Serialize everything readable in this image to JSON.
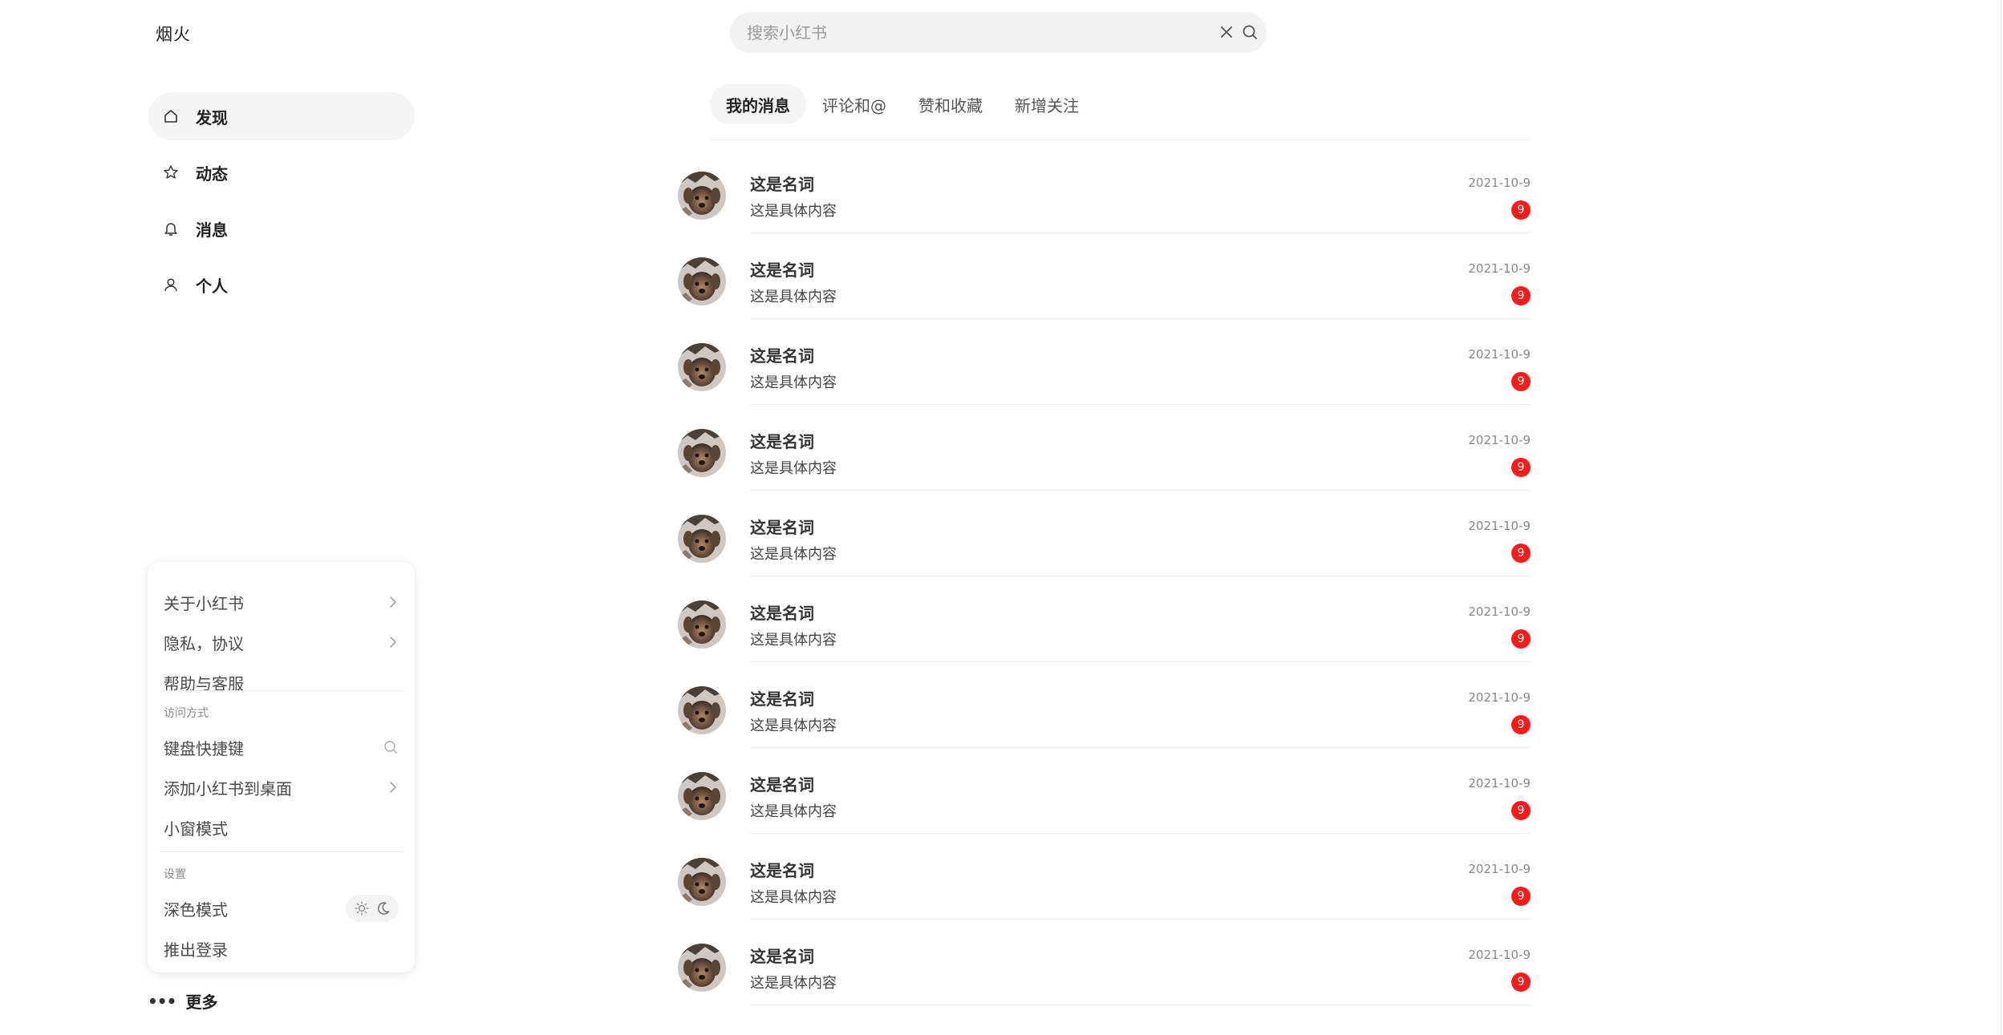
{
  "app": {
    "logo": "烟火"
  },
  "search": {
    "placeholder": "搜索小红书",
    "value": ""
  },
  "sidebar": {
    "items": [
      {
        "label": "发现",
        "icon": "home-icon",
        "active": true
      },
      {
        "label": "动态",
        "icon": "star-icon",
        "active": false
      },
      {
        "label": "消息",
        "icon": "bell-icon",
        "active": false
      },
      {
        "label": "个人",
        "icon": "user-icon",
        "active": false
      }
    ],
    "more_label": "更多"
  },
  "menu": {
    "about": "关于小红书",
    "privacy": "隐私，协议",
    "help": "帮助与客服",
    "access_section": "访问方式",
    "shortcuts": "键盘快捷键",
    "add_to_desktop": "添加小红书到桌面",
    "mini_window": "小窗模式",
    "settings_section": "设置",
    "dark_mode": "深色模式",
    "logout": "推出登录"
  },
  "tabs": [
    {
      "label": "我的消息",
      "active": true
    },
    {
      "label": "评论和@",
      "active": false
    },
    {
      "label": "赞和收藏",
      "active": false
    },
    {
      "label": "新增关注",
      "active": false
    }
  ],
  "messages": [
    {
      "name": "这是名词",
      "content": "这是具体内容",
      "time": "2021-10-9",
      "badge": "9"
    },
    {
      "name": "这是名词",
      "content": "这是具体内容",
      "time": "2021-10-9",
      "badge": "9"
    },
    {
      "name": "这是名词",
      "content": "这是具体内容",
      "time": "2021-10-9",
      "badge": "9"
    },
    {
      "name": "这是名词",
      "content": "这是具体内容",
      "time": "2021-10-9",
      "badge": "9"
    },
    {
      "name": "这是名词",
      "content": "这是具体内容",
      "time": "2021-10-9",
      "badge": "9"
    },
    {
      "name": "这是名词",
      "content": "这是具体内容",
      "time": "2021-10-9",
      "badge": "9"
    },
    {
      "name": "这是名词",
      "content": "这是具体内容",
      "time": "2021-10-9",
      "badge": "9"
    },
    {
      "name": "这是名词",
      "content": "这是具体内容",
      "time": "2021-10-9",
      "badge": "9"
    },
    {
      "name": "这是名词",
      "content": "这是具体内容",
      "time": "2021-10-9",
      "badge": "9"
    },
    {
      "name": "这是名词",
      "content": "这是具体内容",
      "time": "2021-10-9",
      "badge": "9"
    }
  ],
  "colors": {
    "badge": "#ff1b1b",
    "active_bg": "#f5f5f5",
    "text": "#333333"
  }
}
